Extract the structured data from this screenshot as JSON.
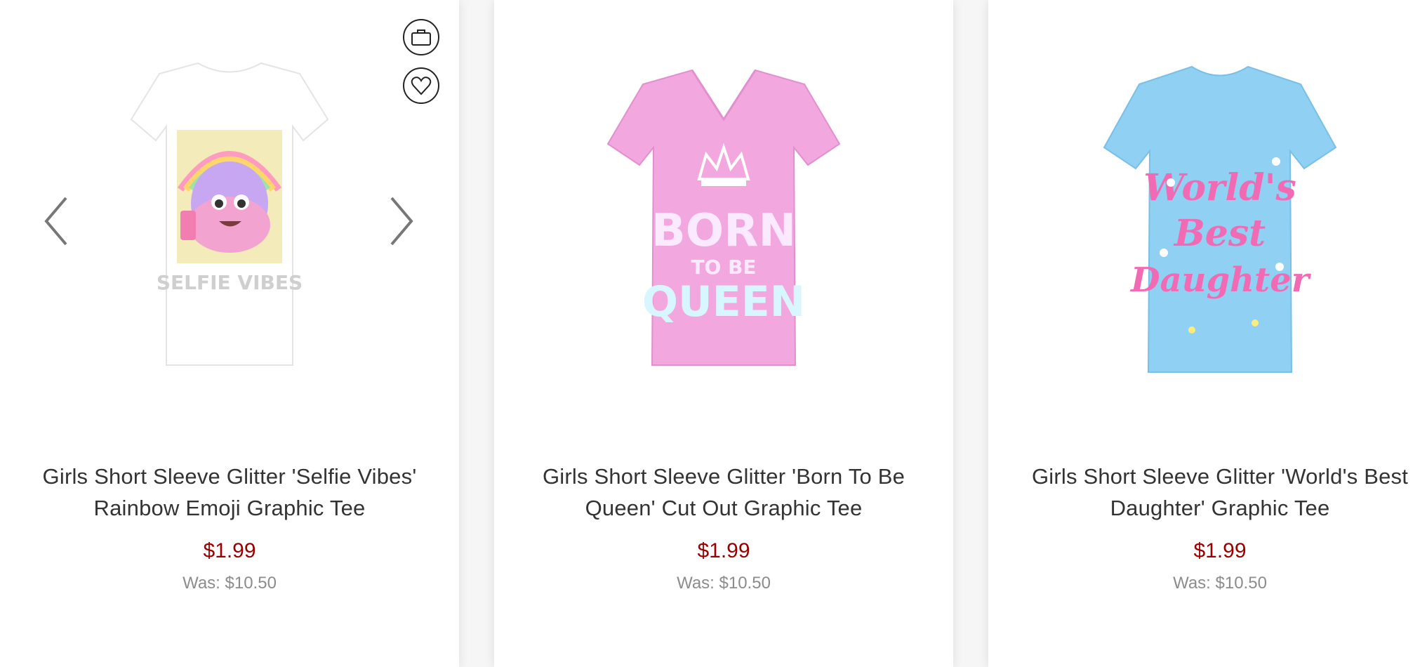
{
  "products": [
    {
      "title": "Girls Short Sleeve Glitter 'Selfie Vibes' Rainbow Emoji Graphic Tee",
      "price": "$1.99",
      "was": "Was: $10.50",
      "shirt_color": "#ffffff",
      "print_text": "SELFIE VIBES"
    },
    {
      "title": "Girls Short Sleeve Glitter 'Born To Be Queen' Cut Out Graphic Tee",
      "price": "$1.99",
      "was": "Was: $10.50",
      "shirt_color": "#f2a7df",
      "print_text": "BORN TO BE QUEEN"
    },
    {
      "title": "Girls Short Sleeve Glitter 'World's Best Daughter' Graphic Tee",
      "price": "$1.99",
      "was": "Was: $10.50",
      "shirt_color": "#8fd0f3",
      "print_text": "World's Best Daughter"
    }
  ],
  "icons": {
    "bag": "shopping-bag-icon",
    "favorite": "heart-icon",
    "prev": "chevron-left-icon",
    "next": "chevron-right-icon"
  },
  "colors": {
    "price": "#9a0000",
    "was": "#8c8c8c",
    "title": "#333333"
  }
}
